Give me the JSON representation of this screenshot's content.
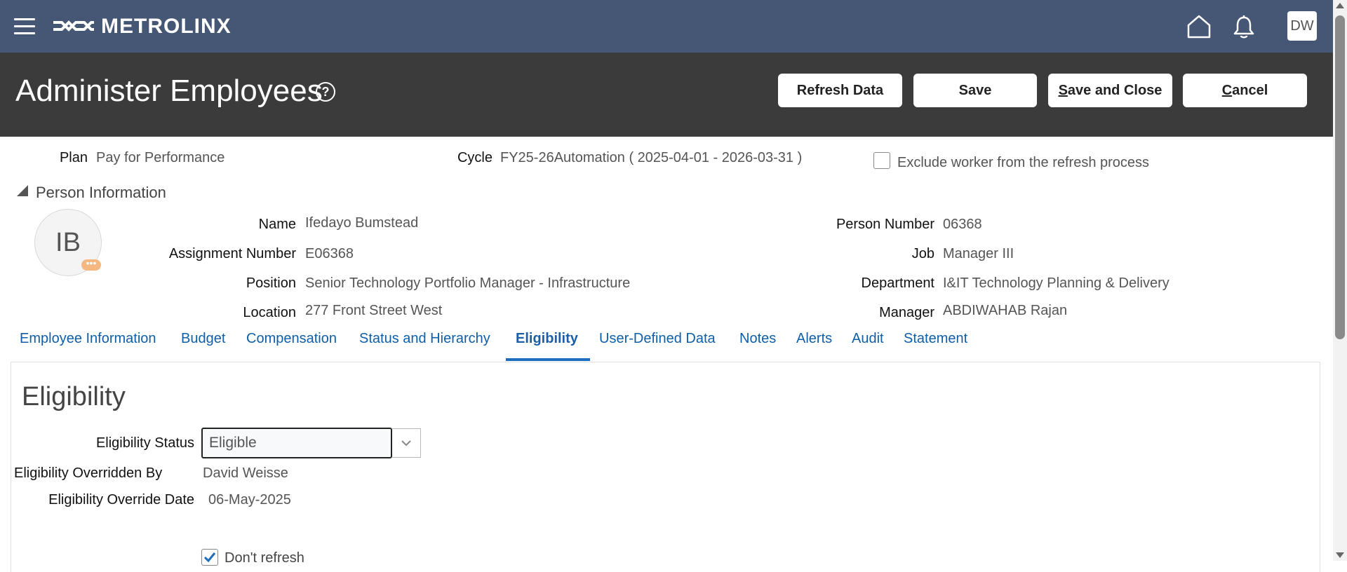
{
  "topbar": {
    "logo_text": "METROLINX",
    "user_initials": "DW",
    "icons": [
      "menu-icon",
      "home-icon",
      "bell-icon"
    ]
  },
  "header": {
    "title": "Administer Employees",
    "help": "?",
    "buttons": {
      "refresh": "Refresh Data",
      "save": "Save",
      "save_close_first": "S",
      "save_close_rest": "ave and Close",
      "cancel_first": "C",
      "cancel_rest": "ancel"
    }
  },
  "plan": {
    "plan_label": "Plan",
    "plan_value": "Pay for Performance",
    "cycle_label": "Cycle",
    "cycle_value": "FY25-26Automation ( 2025-04-01 - 2026-03-31 )",
    "exclude_label": "Exclude worker from the refresh process",
    "exclude_checked": false
  },
  "person": {
    "section_title": "Person Information",
    "initials": "IB",
    "badge": "•••",
    "name_label": "Name",
    "name": "Ifedayo Bumstead",
    "assignment_label": "Assignment Number",
    "assignment": "E06368",
    "position_label": "Position",
    "position": "Senior Technology Portfolio Manager - Infrastructure",
    "location_label": "Location",
    "location": "277 Front Street West",
    "person_number_label": "Person Number",
    "person_number": "06368",
    "job_label": "Job",
    "job": "Manager III",
    "department_label": "Department",
    "department": "I&IT Technology Planning & Delivery",
    "manager_label": "Manager",
    "manager": "ABDIWAHAB Rajan"
  },
  "tabs": [
    "Employee Information",
    "Budget",
    "Compensation",
    "Status and Hierarchy",
    "Eligibility",
    "User-Defined Data",
    "Notes",
    "Alerts",
    "Audit",
    "Statement"
  ],
  "active_tab": "Eligibility",
  "eligibility": {
    "title": "Eligibility",
    "status_label": "Eligibility Status",
    "status_value": "Eligible",
    "overridden_by_label": "Eligibility Overridden By",
    "overridden_by": "David Weisse",
    "override_date_label": "Eligibility Override Date",
    "override_date": "06-May-2025",
    "dont_refresh_label": "Don't refresh",
    "dont_refresh_checked": true
  },
  "colors": {
    "topbar": "#465675",
    "header": "#3b3b3b",
    "link": "#0f5fa8",
    "badge": "#f5b880"
  }
}
